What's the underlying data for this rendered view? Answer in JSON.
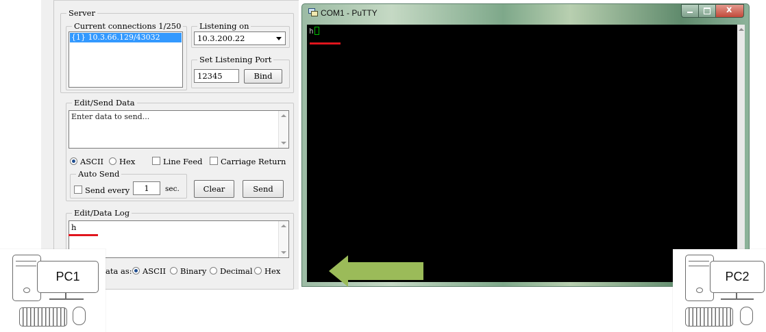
{
  "server": {
    "group_label": "Server",
    "connections_label": "Current connections 1/250",
    "connections": [
      "{1} 10.3.66.129/43032"
    ],
    "listening_on_label": "Listening on",
    "listening_ip": "10.3.200.22",
    "port_label": "Set Listening Port",
    "port_value": "12345",
    "bind_label": "Bind"
  },
  "edit_send": {
    "group_label": "Edit/Send Data",
    "placeholder": "Enter data to send...",
    "opt_ascii": "ASCII",
    "opt_hex": "Hex",
    "opt_linefeed": "Line Feed",
    "opt_cr": "Carriage Return",
    "auto_send_label": "Auto Send",
    "send_every_label": "Send every",
    "interval_value": "1",
    "interval_unit": "sec.",
    "clear_label": "Clear",
    "send_label": "Send"
  },
  "data_log": {
    "group_label": "Edit/Data Log",
    "content": "h",
    "display_as_label": "ata as:",
    "opt_ascii": "ASCII",
    "opt_binary": "Binary",
    "opt_decimal": "Decimal",
    "opt_hex": "Hex"
  },
  "putty": {
    "title": "COM1 - PuTTY",
    "terminal_text": "h"
  },
  "pc1": {
    "label": "PC1"
  },
  "pc2": {
    "label": "PC2"
  },
  "colors": {
    "underline_red": "#e0151d",
    "arrow_green": "#9bbb59",
    "cursor_green": "#00c000",
    "selection_blue": "#3399ff"
  }
}
